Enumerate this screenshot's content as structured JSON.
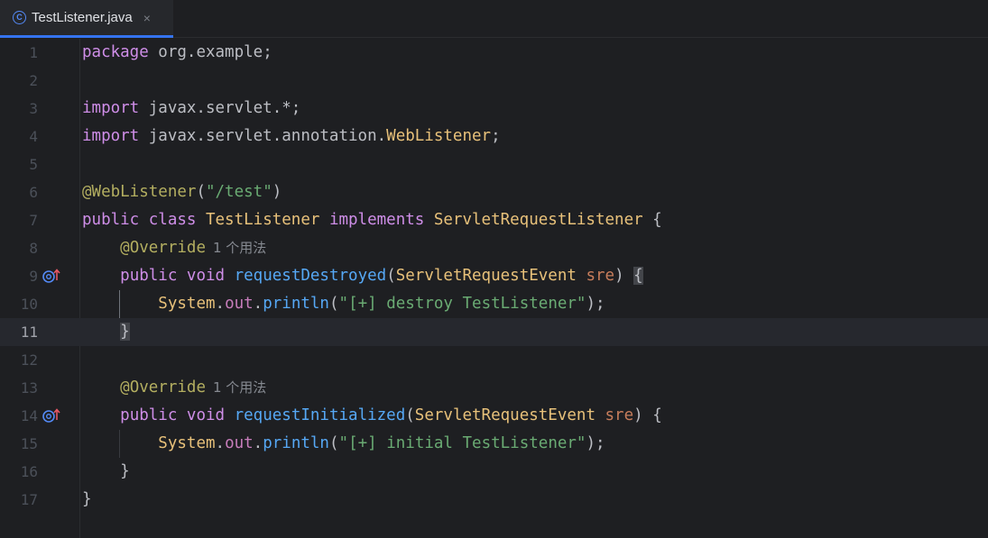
{
  "tab": {
    "file_name": "TestListener.java",
    "file_icon": "java-class-icon",
    "close_glyph": "×"
  },
  "editor": {
    "current_line": 11,
    "line_numbers": [
      "1",
      "2",
      "3",
      "4",
      "5",
      "6",
      "7",
      "8",
      "9",
      "10",
      "11",
      "12",
      "13",
      "14",
      "15",
      "16",
      "17"
    ],
    "lines": {
      "l1_kw": "package",
      "l1_rest": " org.example;",
      "l3_kw": "import",
      "l3_rest": " javax.servlet.*;",
      "l4_kw": "import",
      "l4_pkg": " javax.servlet.annotation.",
      "l4_cls": "WebListener",
      "l4_end": ";",
      "l6_ann": "@WebListener",
      "l6_open": "(",
      "l6_str": "\"/test\"",
      "l6_close": ")",
      "l7_kw1": "public",
      "l7_kw2": " class",
      "l7_cls": " TestListener",
      "l7_kw3": " implements",
      "l7_iface": " ServletRequestListener",
      "l7_brace": " {",
      "l8_ann": "@Override",
      "l8_hint": "1 个用法",
      "l9_kw1": "public",
      "l9_kw2": " void",
      "l9_fn": " requestDestroyed",
      "l9_open": "(",
      "l9_type": "ServletRequestEvent",
      "l9_param": " sre",
      "l9_close": ") ",
      "l9_brace": "{",
      "l10_cls": "System",
      "l10_dot1": ".",
      "l10_fld": "out",
      "l10_dot2": ".",
      "l10_fn": "println",
      "l10_open": "(",
      "l10_str": "\"[+] destroy TestListener\"",
      "l10_close": ");",
      "l11_brace": "}",
      "l13_ann": "@Override",
      "l13_hint": "1 个用法",
      "l14_kw1": "public",
      "l14_kw2": " void",
      "l14_fn": " requestInitialized",
      "l14_open": "(",
      "l14_type": "ServletRequestEvent",
      "l14_param": " sre",
      "l14_close": ") {",
      "l15_cls": "System",
      "l15_dot1": ".",
      "l15_fld": "out",
      "l15_dot2": ".",
      "l15_fn": "println",
      "l15_open": "(",
      "l15_str": "\"[+] initial TestListener\"",
      "l15_close": ");",
      "l16_brace": "}",
      "l17_brace": "}"
    },
    "gutter_icons": {
      "line9": "implementing-method-icon",
      "line14": "implementing-method-icon"
    }
  },
  "colors": {
    "background": "#1e1f22",
    "keyword": "#cf8ee8",
    "annotation": "#b3ae60",
    "class": "#e8c17a",
    "string": "#6aab73",
    "function": "#56a8f5",
    "accent": "#3574f0"
  }
}
